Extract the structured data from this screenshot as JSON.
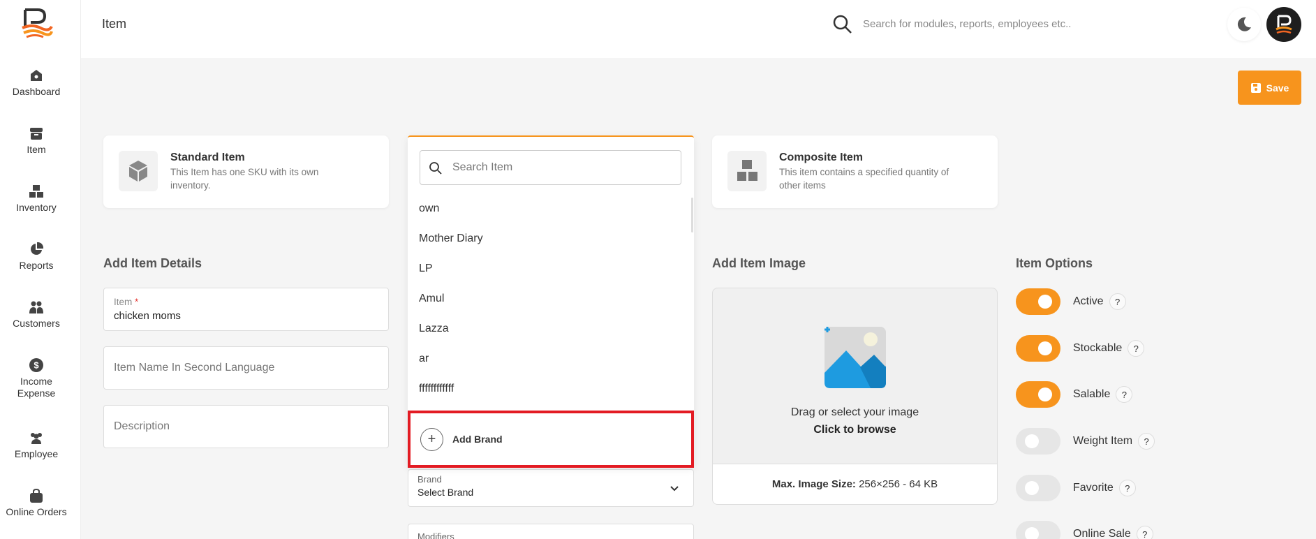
{
  "header": {
    "title": "Item",
    "search_placeholder": "Search for modules, reports, employees etc.."
  },
  "sidebar": {
    "items": [
      {
        "label": "Dashboard",
        "icon": "home-icon"
      },
      {
        "label": "Item",
        "icon": "archive-icon"
      },
      {
        "label": "Inventory",
        "icon": "boxes-icon"
      },
      {
        "label": "Reports",
        "icon": "pie-chart-icon"
      },
      {
        "label": "Customers",
        "icon": "users-icon"
      },
      {
        "label": "Income Expense",
        "icon": "dollar-icon"
      },
      {
        "label": "Employee",
        "icon": "employees-icon"
      },
      {
        "label": "Online Orders",
        "icon": "shopping-bag-icon"
      }
    ]
  },
  "toolbar": {
    "save_label": "Save"
  },
  "item_types": {
    "standard": {
      "title": "Standard Item",
      "desc": "This Item has one SKU with its own inventory."
    },
    "composite": {
      "title": "Composite Item",
      "desc": "This item contains a specified quantity of other items"
    }
  },
  "details": {
    "section_title": "Add Item Details",
    "item_label": "Item",
    "item_required_mark": "*",
    "item_value": "chicken moms",
    "second_lang_placeholder": "Item Name In Second Language",
    "description_placeholder": "Description"
  },
  "brand_dropdown": {
    "search_placeholder": "Search Item",
    "options": [
      "own",
      "Mother Diary",
      "LP",
      "Amul",
      "Lazza",
      "ar",
      "ffffffffffff"
    ],
    "add_label": "Add Brand"
  },
  "brand_field": {
    "label": "Brand",
    "value": "Select Brand"
  },
  "modifiers_field": {
    "label": "Modifiers"
  },
  "image": {
    "section_title": "Add Item Image",
    "drag_text": "Drag or select your image",
    "browse_text": "Click to browse",
    "max_size_label": "Max. Image Size:",
    "max_size_value": "256×256 - 64 KB"
  },
  "options": {
    "section_title": "Item Options",
    "help_mark": "?",
    "items": [
      {
        "label": "Active",
        "on": true
      },
      {
        "label": "Stockable",
        "on": true
      },
      {
        "label": "Salable",
        "on": true
      },
      {
        "label": "Weight Item",
        "on": false
      },
      {
        "label": "Favorite",
        "on": false
      },
      {
        "label": "Online Sale",
        "on": false
      }
    ]
  },
  "colors": {
    "accent": "#f7941d",
    "highlight": "#e31b23"
  }
}
